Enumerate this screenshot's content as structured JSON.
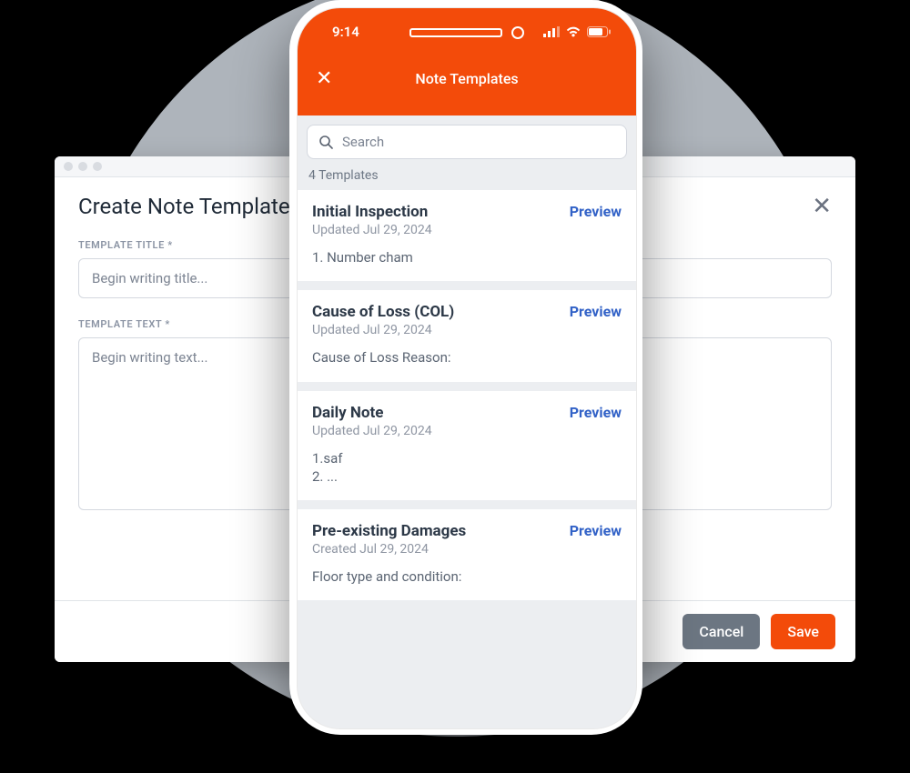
{
  "status": {
    "time": "9:14"
  },
  "desktop": {
    "title": "Create Note Template",
    "field_title_label": "TEMPLATE TITLE *",
    "title_placeholder": "Begin writing title...",
    "field_text_label": "TEMPLATE TEXT *",
    "text_placeholder": "Begin writing text...",
    "cancel_label": "Cancel",
    "save_label": "Save"
  },
  "phone": {
    "header_title": "Note Templates",
    "search_placeholder": "Search",
    "count_label": "4 Templates",
    "preview_label": "Preview",
    "templates": [
      {
        "title": "Initial Inspection",
        "meta": "Updated Jul 29, 2024",
        "body": "1. Number cham"
      },
      {
        "title": "Cause of Loss (COL)",
        "meta": "Updated Jul 29, 2024",
        "body": "Cause of Loss Reason:"
      },
      {
        "title": "Daily Note",
        "meta": "Updated Jul 29, 2024",
        "body": "1.saf\n2. ..."
      },
      {
        "title": "Pre-existing Damages",
        "meta": "Created Jul 29, 2024",
        "body": "Floor type and condition:"
      }
    ]
  },
  "colors": {
    "accent": "#f34b0a",
    "link": "#3262c7"
  }
}
